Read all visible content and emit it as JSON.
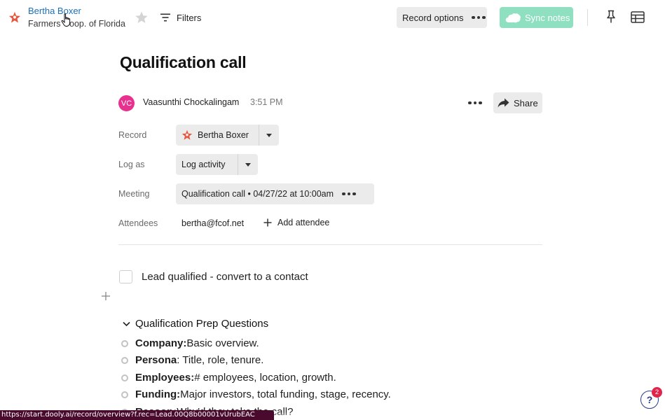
{
  "header": {
    "record_name": "Bertha Boxer",
    "record_company": "Farmers Coop. of Florida",
    "filters_label": "Filters",
    "record_options_label": "Record options",
    "sync_notes_label": "Sync notes",
    "accent_color": "#e8553a",
    "sync_color": "#8fe0c0"
  },
  "note": {
    "title": "Qualification call",
    "author_initials": "VC",
    "author_name": "Vaasunthi Chockalingam",
    "time": "3:51 PM",
    "share_label": "Share"
  },
  "fields": {
    "record_label": "Record",
    "record_value": "Bertha Boxer",
    "log_as_label": "Log as",
    "log_as_value": "Log activity",
    "meeting_label": "Meeting",
    "meeting_value": "Qualification call • 04/27/22 at 10:00am",
    "attendees_label": "Attendees",
    "attendee_email": "bertha@fcof.net",
    "add_attendee_label": "Add attendee"
  },
  "body": {
    "checklist_item": "Lead qualified - convert to a contact",
    "section_title": "Qualification Prep Questions",
    "bullets": [
      {
        "term": "Company:",
        "text": " Basic overview."
      },
      {
        "term": "Persona",
        "text": ": Title, role, tenure."
      },
      {
        "term": "Employees:",
        "text": " # employees, location, growth."
      },
      {
        "term": "Funding:",
        "text": " Major investors, total funding, stage, recency."
      },
      {
        "term": "Reason:",
        "text": " Why'd they take the call?"
      }
    ]
  },
  "help": {
    "icon_label": "?",
    "badge_count": "2"
  },
  "status_url": "https://start.dooly.ai/record/overview?f.rec=Lead.00Q8b00001vUrubEAC"
}
